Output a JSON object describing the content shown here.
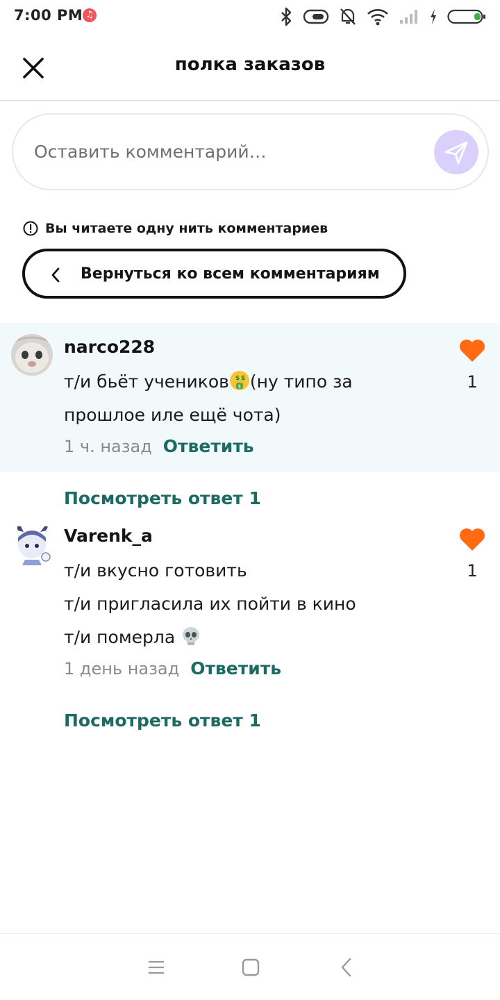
{
  "status_bar": {
    "time": "7:00 PM"
  },
  "header": {
    "title": "полка заказов"
  },
  "comment_box": {
    "placeholder": "Оставить комментарий…"
  },
  "thread": {
    "notice": "Вы читаете одну нить комментариев",
    "back_label": "Вернуться ко всем комментариям"
  },
  "comments": [
    {
      "username": "narco228",
      "lines": [
        "т/и бьёт учеников",
        "(ну типо за",
        "прошлое иле ещё чота)"
      ],
      "time": "1 ч. назад",
      "reply": "Ответить",
      "likes": "1",
      "view_replies": "Посмотреть ответ 1"
    },
    {
      "username": "Varenk_a",
      "lines": [
        "т/и вкусно готовить",
        "т/и пригласила их пойти в кино",
        "т/и померла"
      ],
      "time": "1 день назад",
      "reply": "Ответить",
      "likes": "1",
      "view_replies": "Посмотреть ответ 1"
    }
  ],
  "colors": {
    "accent_teal": "#1c6a63",
    "heart_orange": "#ff6a13",
    "send_bg": "#d9d1fb",
    "highlight_bg": "#f1f9fb"
  }
}
